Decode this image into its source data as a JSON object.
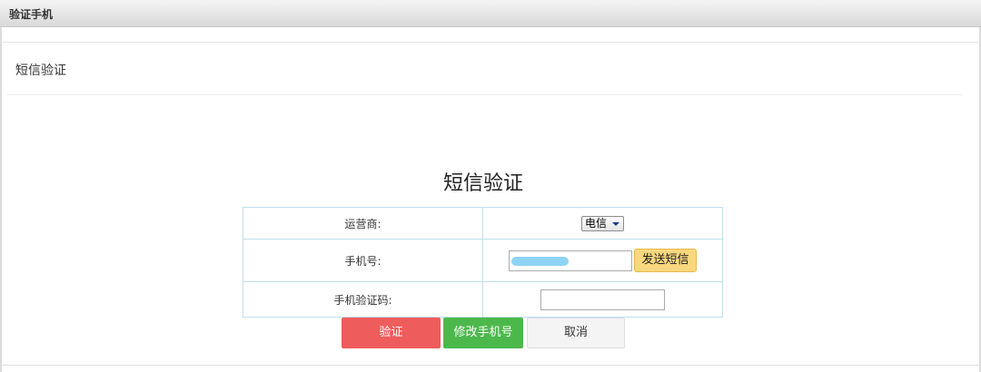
{
  "window": {
    "title": "验证手机"
  },
  "header": {
    "title": "短信验证"
  },
  "form": {
    "title": "短信验证",
    "rows": {
      "carrier": {
        "label": "运营商:",
        "selected": "电信"
      },
      "phone": {
        "label": "手机号:",
        "send_label": "发送短信"
      },
      "code": {
        "label": "手机验证码:",
        "value": ""
      }
    }
  },
  "actions": {
    "verify_label": "验证",
    "change_phone_label": "修改手机号",
    "cancel_label": "取消"
  },
  "colors": {
    "verify": "#ef5c5c",
    "change_phone": "#4cb84c",
    "send_sms": "#f9d77e",
    "table_border": "#bfe0ee"
  },
  "icons": {
    "select_caret": "chevron-down-icon"
  }
}
